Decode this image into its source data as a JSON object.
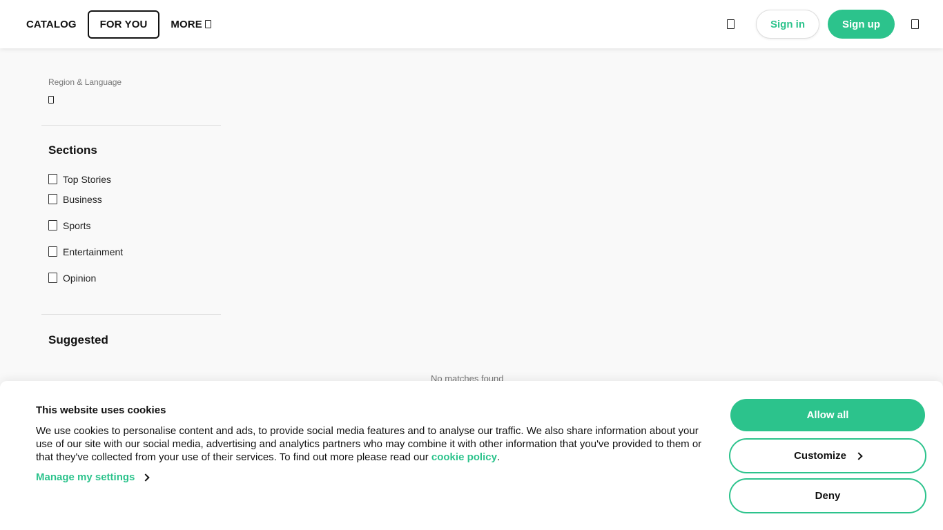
{
  "topbar": {
    "nav": [
      {
        "label": "CATALOG"
      },
      {
        "label": "FOR YOU",
        "active": true
      },
      {
        "label": "MORE"
      }
    ],
    "sign_in_label": "Sign in",
    "sign_up_label": "Sign up",
    "icons": [
      "more-dropdown-icon",
      "search-icon",
      "menu-icon"
    ]
  },
  "sidebar": {
    "region_label": "Region & Language",
    "region_icon": "globe-icon",
    "sections_title": "Sections",
    "sections": [
      {
        "label": "Top Stories",
        "checked": false
      },
      {
        "label": "Business",
        "checked": false
      },
      {
        "label": "Sports",
        "checked": false
      },
      {
        "label": "Entertainment",
        "checked": false
      },
      {
        "label": "Opinion",
        "checked": false
      }
    ],
    "suggested_title": "Suggested"
  },
  "main": {
    "empty_text": "No matches found"
  },
  "cookie": {
    "title": "This website uses cookies",
    "body": "We use cookies to personalise content and ads, to provide social media features and to analyse our traffic. We also share information about your use of our site with our social media, advertising and analytics partners who may combine it with other information that you've provided to them or that they've collected from your use of their services. To find out more please read our ",
    "link_label": "cookie policy",
    "body_end": ".",
    "manage_label": "Manage my settings",
    "allow_label": "Allow all",
    "customize_label": "Customize",
    "deny_label": "Deny"
  },
  "colors": {
    "accent": "#2cc38c",
    "page_bg": "#f9f9f9",
    "text": "#111111"
  }
}
